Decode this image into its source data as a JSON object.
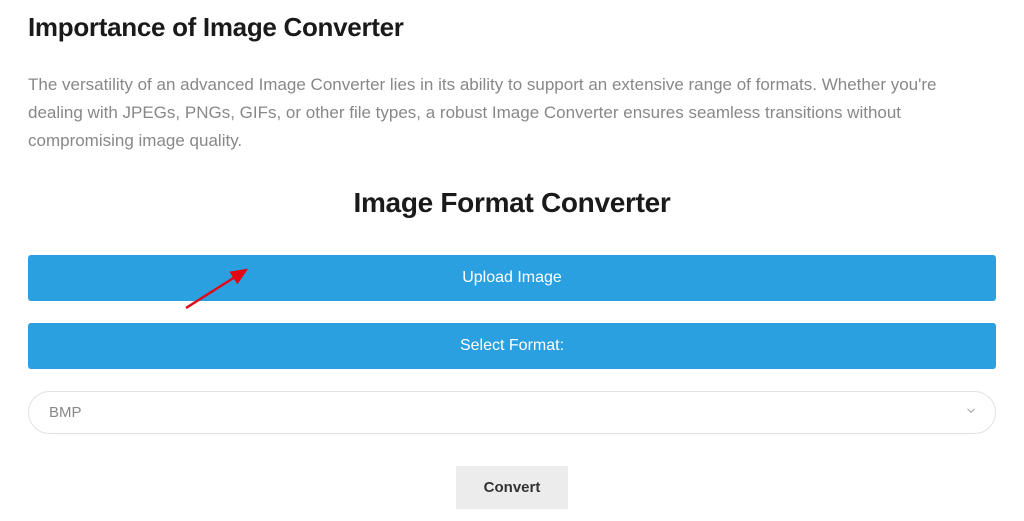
{
  "section": {
    "heading": "Importance of Image Converter",
    "description": "The versatility of an advanced Image Converter lies in its ability to support an extensive range of formats. Whether you're dealing with JPEGs, PNGs, GIFs, or other file types, a robust Image Converter ensures seamless transitions without compromising image quality."
  },
  "tool": {
    "heading": "Image Format Converter",
    "upload_label": "Upload Image",
    "select_label": "Select Format:",
    "selected_format": "BMP",
    "convert_label": "Convert"
  }
}
